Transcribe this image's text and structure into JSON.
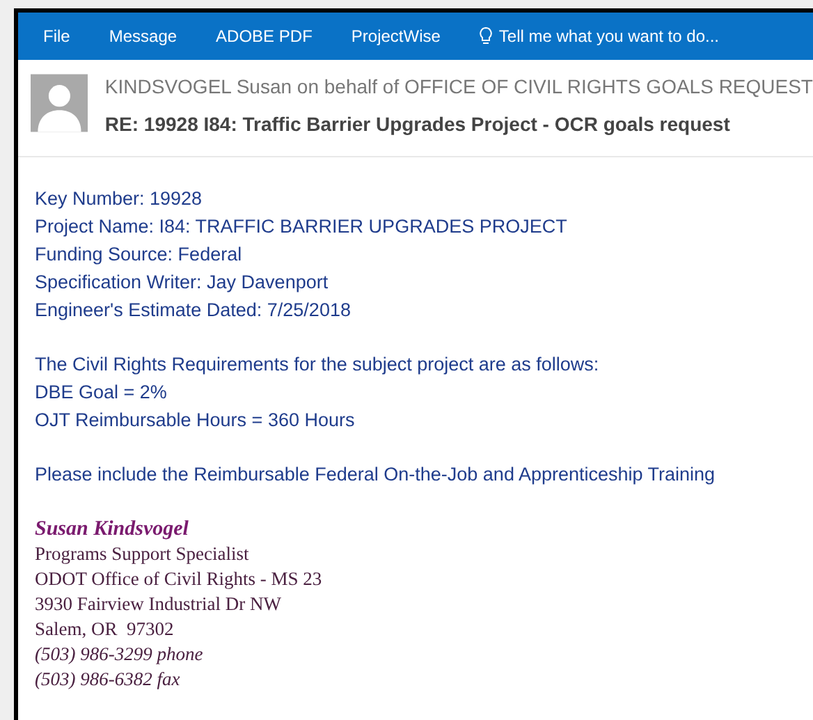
{
  "ribbon": {
    "tabs": [
      {
        "label": "File"
      },
      {
        "label": "Message"
      },
      {
        "label": "ADOBE PDF"
      },
      {
        "label": "ProjectWise"
      }
    ],
    "tell_me": "Tell me what you want to do..."
  },
  "header": {
    "sender": "KINDSVOGEL Susan on behalf of OFFICE OF CIVIL RIGHTS GOALS REQUEST",
    "subject": "RE: 19928 I84: Traffic Barrier Upgrades Project - OCR goals request"
  },
  "body": {
    "paragraphs": [
      [
        "Key Number: 19928",
        "Project Name: I84: TRAFFIC BARRIER UPGRADES PROJECT",
        "Funding Source: Federal",
        "Specification Writer: Jay Davenport",
        "Engineer's Estimate Dated: 7/25/2018"
      ],
      [
        "The Civil Rights Requirements for the subject project are as follows:",
        "DBE Goal = 2%",
        "OJT Reimbursable Hours = 360 Hours"
      ],
      [
        "Please include the Reimbursable Federal On-the-Job and Apprenticeship Training"
      ]
    ]
  },
  "signature": [
    {
      "kind": "name",
      "text": "Susan Kindsvogel"
    },
    {
      "kind": "line",
      "text": "Programs Support Specialist"
    },
    {
      "kind": "line",
      "text": "ODOT Office of Civil Rights - MS 23"
    },
    {
      "kind": "line",
      "text": "3930 Fairview Industrial Dr NW"
    },
    {
      "kind": "line",
      "text": "Salem, OR  97302"
    },
    {
      "kind": "italic",
      "text": "(503) 986-3299 phone"
    },
    {
      "kind": "italic",
      "text": "(503) 986-6382 fax"
    }
  ]
}
